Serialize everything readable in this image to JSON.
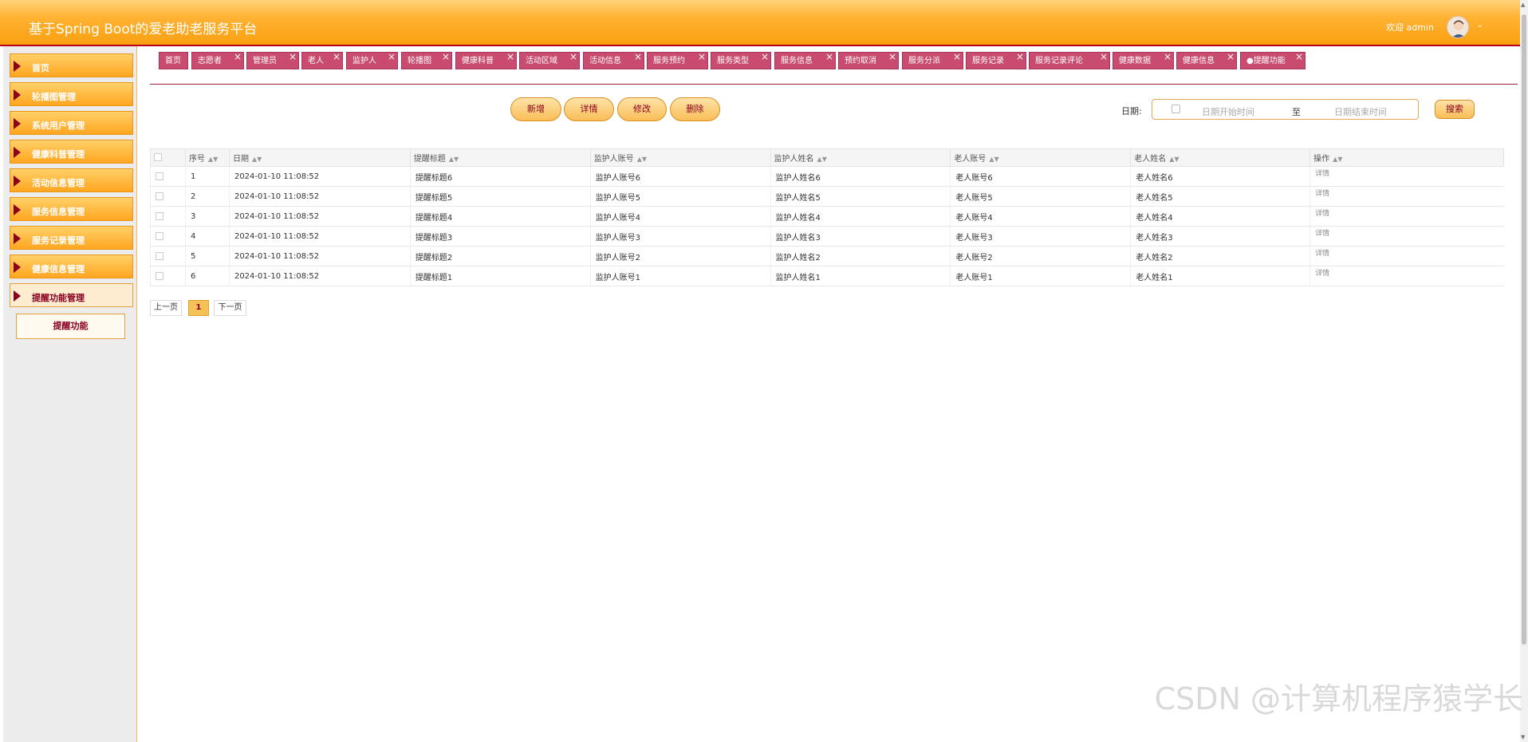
{
  "header": {
    "title": "基于Spring Boot的爱老助老服务平台",
    "welcome": "欢迎 admin"
  },
  "sidebar": {
    "items": [
      {
        "label": "首页"
      },
      {
        "label": "轮播图管理"
      },
      {
        "label": "系统用户管理"
      },
      {
        "label": "健康科普管理"
      },
      {
        "label": "活动信息管理"
      },
      {
        "label": "服务信息管理"
      },
      {
        "label": "服务记录管理"
      },
      {
        "label": "健康信息管理"
      },
      {
        "label": "提醒功能管理"
      }
    ],
    "sub_item": "提醒功能"
  },
  "tabs": [
    "首页",
    "志愿者",
    "管理员",
    "老人",
    "监护人",
    "轮播图",
    "健康科普",
    "活动区域",
    "活动信息",
    "服务预约",
    "服务类型",
    "服务信息",
    "预约取消",
    "服务分派",
    "服务记录",
    "服务记录评论",
    "健康数据",
    "健康信息",
    "●提醒功能"
  ],
  "actions": {
    "add": "新增",
    "detail": "详情",
    "edit": "修改",
    "delete": "删除",
    "search": "搜索"
  },
  "filter": {
    "date_label": "日期:",
    "start_placeholder": "日期开始时间",
    "separator": "至",
    "end_placeholder": "日期结束时间"
  },
  "table": {
    "columns": [
      "序号",
      "日期",
      "提醒标题",
      "监护人账号",
      "监护人姓名",
      "老人账号",
      "老人姓名",
      "操作"
    ],
    "rows": [
      [
        "1",
        "2024-01-10 11:08:52",
        "提醒标题6",
        "监护人账号6",
        "监护人姓名6",
        "老人账号6",
        "老人姓名6",
        "详情"
      ],
      [
        "2",
        "2024-01-10 11:08:52",
        "提醒标题5",
        "监护人账号5",
        "监护人姓名5",
        "老人账号5",
        "老人姓名5",
        "详情"
      ],
      [
        "3",
        "2024-01-10 11:08:52",
        "提醒标题4",
        "监护人账号4",
        "监护人姓名4",
        "老人账号4",
        "老人姓名4",
        "详情"
      ],
      [
        "4",
        "2024-01-10 11:08:52",
        "提醒标题3",
        "监护人账号3",
        "监护人姓名3",
        "老人账号3",
        "老人姓名3",
        "详情"
      ],
      [
        "5",
        "2024-01-10 11:08:52",
        "提醒标题2",
        "监护人账号2",
        "监护人姓名2",
        "老人账号2",
        "老人姓名2",
        "详情"
      ],
      [
        "6",
        "2024-01-10 11:08:52",
        "提醒标题1",
        "监护人账号1",
        "监护人姓名1",
        "老人账号1",
        "老人姓名1",
        "详情"
      ]
    ]
  },
  "pagination": {
    "prev": "上一页",
    "current": "1",
    "next": "下一页"
  },
  "watermark": "CSDN @计算机程序猿学长",
  "colors": {
    "header": "#ffb232",
    "accent": "#8b0020",
    "tab": "#c94c70"
  }
}
